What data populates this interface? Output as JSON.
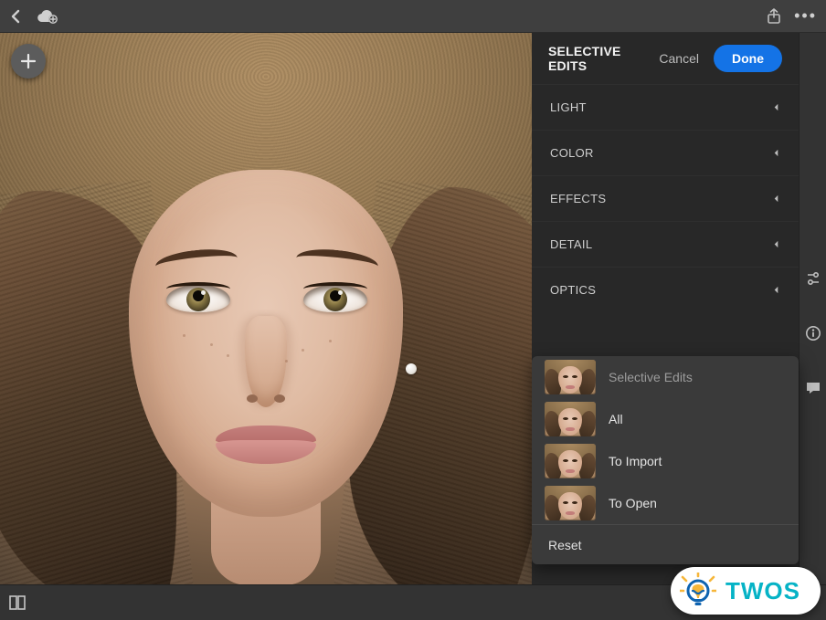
{
  "topbar": {
    "back_icon": "back",
    "cloud_icon": "cloud-add",
    "share_icon": "share",
    "more_icon": "more"
  },
  "overlay": {
    "add_icon": "plus"
  },
  "panel": {
    "title": "SELECTIVE EDITS",
    "cancel_label": "Cancel",
    "done_label": "Done",
    "sections": [
      {
        "label": "LIGHT"
      },
      {
        "label": "COLOR"
      },
      {
        "label": "EFFECTS"
      },
      {
        "label": "DETAIL"
      },
      {
        "label": "OPTICS"
      }
    ]
  },
  "popup": {
    "header_label": "Selective Edits",
    "items": [
      {
        "label": "All"
      },
      {
        "label": "To Import"
      },
      {
        "label": "To Open"
      }
    ],
    "footer_label": "Reset"
  },
  "rail": {
    "adjust_icon": "sliders",
    "info_icon": "info",
    "comment_icon": "comment"
  },
  "bottombar": {
    "filmstrip_icon": "filmstrip"
  },
  "badge": {
    "text": "TWOS"
  },
  "colors": {
    "accent": "#1473e6",
    "brand": "#06b3c6"
  }
}
